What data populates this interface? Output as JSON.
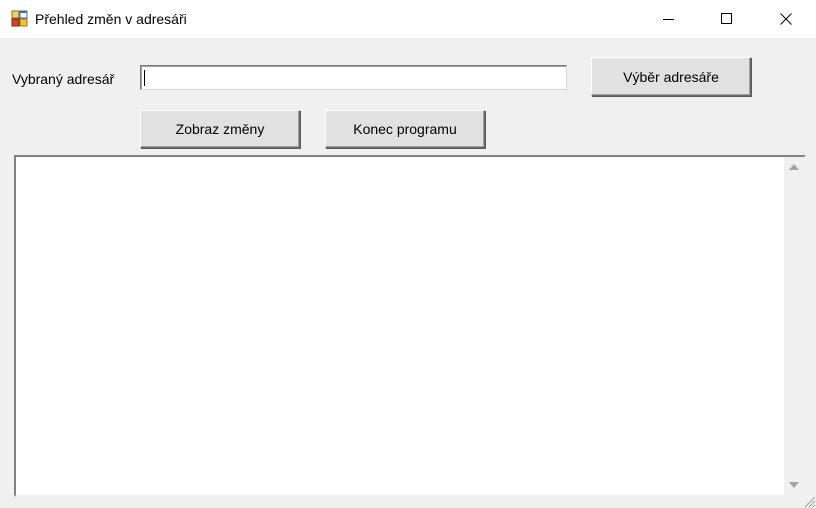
{
  "window": {
    "title": "Přehled změn v adresáři",
    "icons": {
      "app": "app-window-icon",
      "minimize": "minimize-icon",
      "maximize": "maximize-icon",
      "close": "close-icon"
    }
  },
  "form": {
    "directory_label": "Vybraný adresář",
    "directory_value": "",
    "select_button": "Výběr adresáře",
    "show_changes_button": "Zobraz změny",
    "exit_button": "Konec programu"
  },
  "output": {
    "text": "",
    "scroll_up_icon": "scroll-up-arrow-icon",
    "scroll_down_icon": "scroll-down-arrow-icon"
  }
}
